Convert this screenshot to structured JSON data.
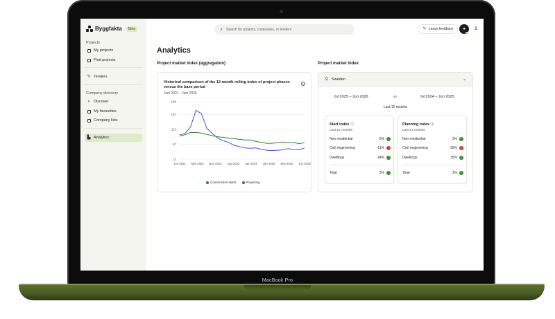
{
  "device": {
    "label": "MacBook Pro"
  },
  "app": {
    "name": "Byggfakta",
    "badge": "Beta"
  },
  "sidebar": {
    "projects_heading": "Projects",
    "company_heading": "Company directory",
    "items": [
      {
        "label": "My projects",
        "icon": "bookmark-icon"
      },
      {
        "label": "Find projects",
        "icon": "search-icon"
      },
      {
        "label": "Tenders",
        "icon": "pen-icon"
      },
      {
        "label": "Discover",
        "icon": "search-icon"
      },
      {
        "label": "My favourites",
        "icon": "heart-icon"
      },
      {
        "label": "Company lists",
        "icon": "list-icon"
      },
      {
        "label": "Analytics",
        "icon": "chart-icon",
        "active": true
      }
    ]
  },
  "topbar": {
    "search_placeholder": "Search for projects, companies, or tenders",
    "feedback_label": "Leave feedback"
  },
  "page": {
    "title": "Analytics",
    "left_section": "Project market index (aggregation)",
    "right_section": "Project market index"
  },
  "chart_card": {
    "title": "Historical comparison of the 12-month rolling index of project phases versus the base period",
    "subtitle": "Juni 2021 - Juni 2026"
  },
  "chart_data": {
    "type": "line",
    "x": [
      "Jun 2021",
      "Mar 2022",
      "Nov 2022",
      "Aug 2023",
      "Apr 2024",
      "Jan 2025",
      "Sep 2025",
      "Jun 2026"
    ],
    "yticks": [
      196,
      157,
      112,
      67,
      22
    ],
    "ylim": [
      22,
      196
    ],
    "series": [
      {
        "name": "Construction starts",
        "color": "#2f7d2a",
        "values": [
          92,
          96,
          103,
          103,
          101,
          97,
          93,
          90,
          88,
          86,
          84,
          82,
          80,
          80,
          76,
          73,
          70,
          70,
          72,
          74,
          72,
          72,
          69,
          72
        ]
      },
      {
        "name": "Projecting",
        "color": "#3b56c9",
        "values": [
          95,
          100,
          120,
          170,
          160,
          115,
          100,
          86,
          78,
          73,
          64,
          60,
          56,
          55,
          56,
          52,
          49,
          48,
          49,
          50,
          54,
          51,
          50,
          56
        ]
      }
    ]
  },
  "market": {
    "region": "Sweden",
    "period_current": "Jul 2025 – Jun 2026",
    "vs": "vs",
    "period_base": "Jul 2024 – Jun 2025",
    "last_12": "Last 12 months",
    "start_index": {
      "title": "Start index",
      "sub": "Last 12 months",
      "rows": [
        {
          "label": "Non residential",
          "value": "6%",
          "trend": "up"
        },
        {
          "label": "Civil engineering",
          "value": "-11%",
          "trend": "down"
        },
        {
          "label": "Dwellings",
          "value": "14%",
          "trend": "up"
        }
      ],
      "total_label": "Total",
      "total_value": "2%"
    },
    "planning_index": {
      "title": "Planning index",
      "sub": "Last 12 months",
      "rows": [
        {
          "label": "Non residential",
          "value": "1%",
          "trend": "up"
        },
        {
          "label": "Civil engineering",
          "value": "-16%",
          "trend": "down"
        },
        {
          "label": "Dwellings",
          "value": "15%",
          "trend": "up"
        }
      ],
      "total_label": "Total",
      "total_value": "1%"
    }
  }
}
